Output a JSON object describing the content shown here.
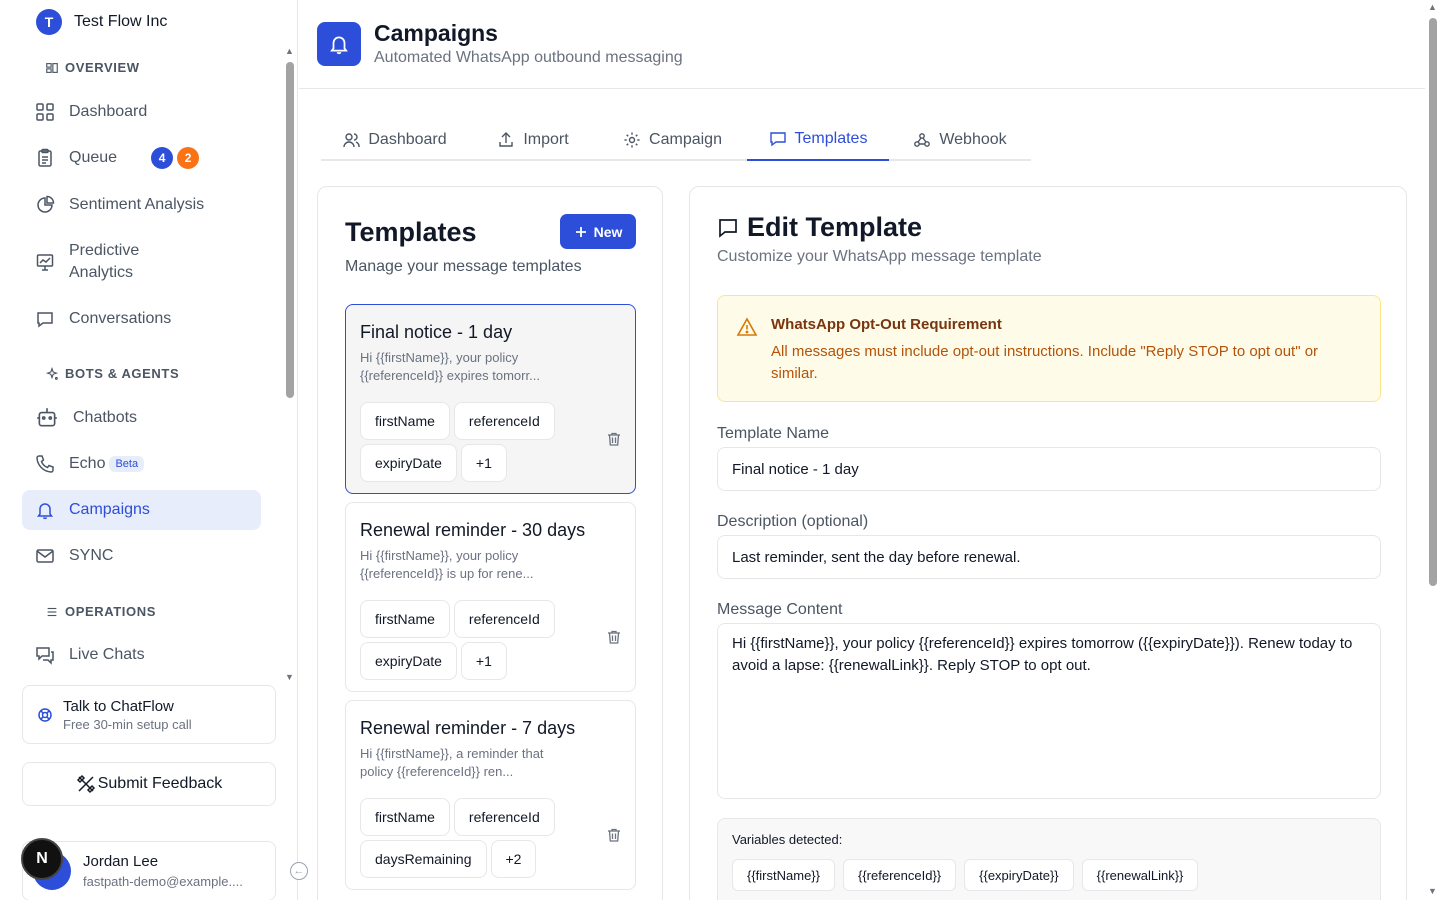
{
  "org": {
    "initial": "T",
    "name": "Test Flow Inc"
  },
  "sidebar": {
    "sections": {
      "overview": "OVERVIEW",
      "bots": "BOTS & AGENTS",
      "operations": "OPERATIONS"
    },
    "items": [
      {
        "label": "Dashboard"
      },
      {
        "label": "Queue",
        "badges": [
          "4",
          "2"
        ]
      },
      {
        "label": "Sentiment Analysis"
      },
      {
        "label": "Predictive Analytics"
      },
      {
        "label": "Conversations"
      },
      {
        "label": "Chatbots"
      },
      {
        "label": "Echo",
        "tag": "Beta"
      },
      {
        "label": "Campaigns"
      },
      {
        "label": "SYNC"
      },
      {
        "label": "Live Chats"
      }
    ],
    "talk": {
      "title": "Talk to ChatFlow",
      "subtitle": "Free 30-min setup call"
    },
    "feedback": "Submit Feedback",
    "user": {
      "name": "Jordan Lee",
      "email": "fastpath-demo@example....",
      "avatar_letter": "N"
    }
  },
  "header": {
    "title": "Campaigns",
    "subtitle": "Automated WhatsApp outbound messaging"
  },
  "tabs": [
    {
      "label": "Dashboard",
      "icon": "users-icon"
    },
    {
      "label": "Import",
      "icon": "upload-icon"
    },
    {
      "label": "Campaign",
      "icon": "gear-icon"
    },
    {
      "label": "Templates",
      "icon": "message-icon",
      "active": true
    },
    {
      "label": "Webhook",
      "icon": "webhook-icon"
    }
  ],
  "templates_panel": {
    "title": "Templates",
    "subtitle": "Manage your message templates",
    "new_button": "New",
    "cards": [
      {
        "name": "Final notice - 1 day",
        "preview": "Hi {{firstName}}, your policy {{referenceId}} expires tomorr...",
        "chips": [
          "firstName",
          "referenceId",
          "expiryDate",
          "+1"
        ]
      },
      {
        "name": "Renewal reminder - 30 days",
        "preview": "Hi {{firstName}}, your policy {{referenceId}} is up for rene...",
        "chips": [
          "firstName",
          "referenceId",
          "expiryDate",
          "+1"
        ]
      },
      {
        "name": "Renewal reminder - 7 days",
        "preview": "Hi {{firstName}}, a reminder that policy {{referenceId}} ren...",
        "chips": [
          "firstName",
          "referenceId",
          "daysRemaining",
          "+2"
        ]
      }
    ]
  },
  "edit_panel": {
    "title": "Edit Template",
    "subtitle": "Customize your WhatsApp message template",
    "warning": {
      "title": "WhatsApp Opt-Out Requirement",
      "text": "All messages must include opt-out instructions. Include \"Reply STOP to opt out\" or similar."
    },
    "name_label": "Template Name",
    "name_value": "Final notice - 1 day",
    "description_label": "Description (optional)",
    "description_value": "Last reminder, sent the day before renewal.",
    "content_label": "Message Content",
    "content_value": "Hi {{firstName}}, your policy {{referenceId}} expires tomorrow ({{expiryDate}}). Renew today to avoid a lapse: {{renewalLink}}. Reply STOP to opt out.",
    "variables_label": "Variables detected:",
    "variables": [
      "{{firstName}}",
      "{{referenceId}}",
      "{{expiryDate}}",
      "{{renewalLink}}"
    ]
  },
  "colors": {
    "accent": "#2d4ed8",
    "badge_orange": "#f97316",
    "warning_bg": "#fefce8",
    "warning_text": "#b45309"
  }
}
